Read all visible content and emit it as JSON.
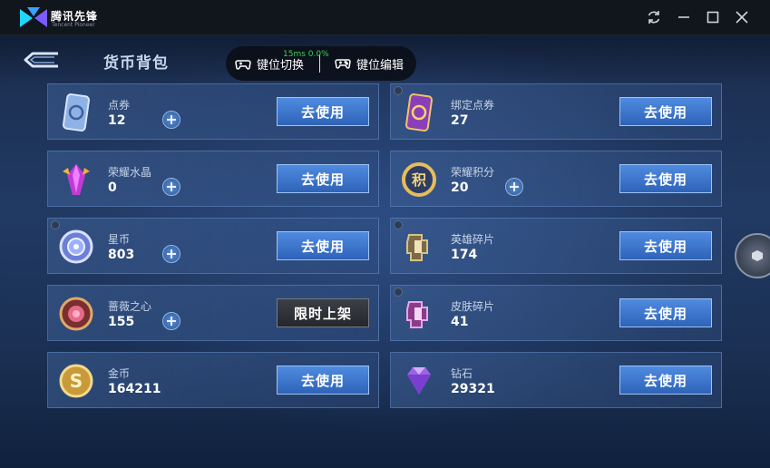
{
  "window": {
    "app_name": "腾讯先锋",
    "app_sub": "Tencent Pioneer"
  },
  "header": {
    "page_title": "货币背包",
    "overlay": {
      "key_switch_label": "键位切换",
      "key_edit_label": "键位编辑",
      "fps_text": "15ms 0.0%"
    }
  },
  "items": [
    {
      "name": "点券",
      "value": "12",
      "action": "去使用",
      "has_plus": true,
      "hint": false,
      "icon": "coupon-icon"
    },
    {
      "name": "绑定点券",
      "value": "27",
      "action": "去使用",
      "has_plus": false,
      "hint": true,
      "icon": "bound-coupon-icon"
    },
    {
      "name": "荣耀水晶",
      "value": "0",
      "action": "去使用",
      "has_plus": true,
      "hint": false,
      "icon": "glory-crystal-icon"
    },
    {
      "name": "荣耀积分",
      "value": "20",
      "action": "去使用",
      "has_plus": true,
      "hint": false,
      "icon": "glory-points-icon"
    },
    {
      "name": "星币",
      "value": "803",
      "action": "去使用",
      "has_plus": true,
      "hint": true,
      "icon": "star-coin-icon"
    },
    {
      "name": "英雄碎片",
      "value": "174",
      "action": "去使用",
      "has_plus": false,
      "hint": true,
      "icon": "hero-fragment-icon"
    },
    {
      "name": "蔷薇之心",
      "value": "155",
      "action": "限时上架",
      "has_plus": true,
      "hint": false,
      "icon": "rose-heart-icon"
    },
    {
      "name": "皮肤碎片",
      "value": "41",
      "action": "去使用",
      "has_plus": false,
      "hint": true,
      "icon": "skin-fragment-icon"
    },
    {
      "name": "金币",
      "value": "164211",
      "action": "去使用",
      "has_plus": false,
      "hint": false,
      "icon": "gold-coin-icon"
    },
    {
      "name": "钻石",
      "value": "29321",
      "action": "去使用",
      "has_plus": false,
      "hint": false,
      "icon": "diamond-icon"
    }
  ],
  "colors": {
    "accent_blue": "#2e63b8",
    "fps_green": "#38d45a",
    "card_border": "#6e96d2"
  }
}
